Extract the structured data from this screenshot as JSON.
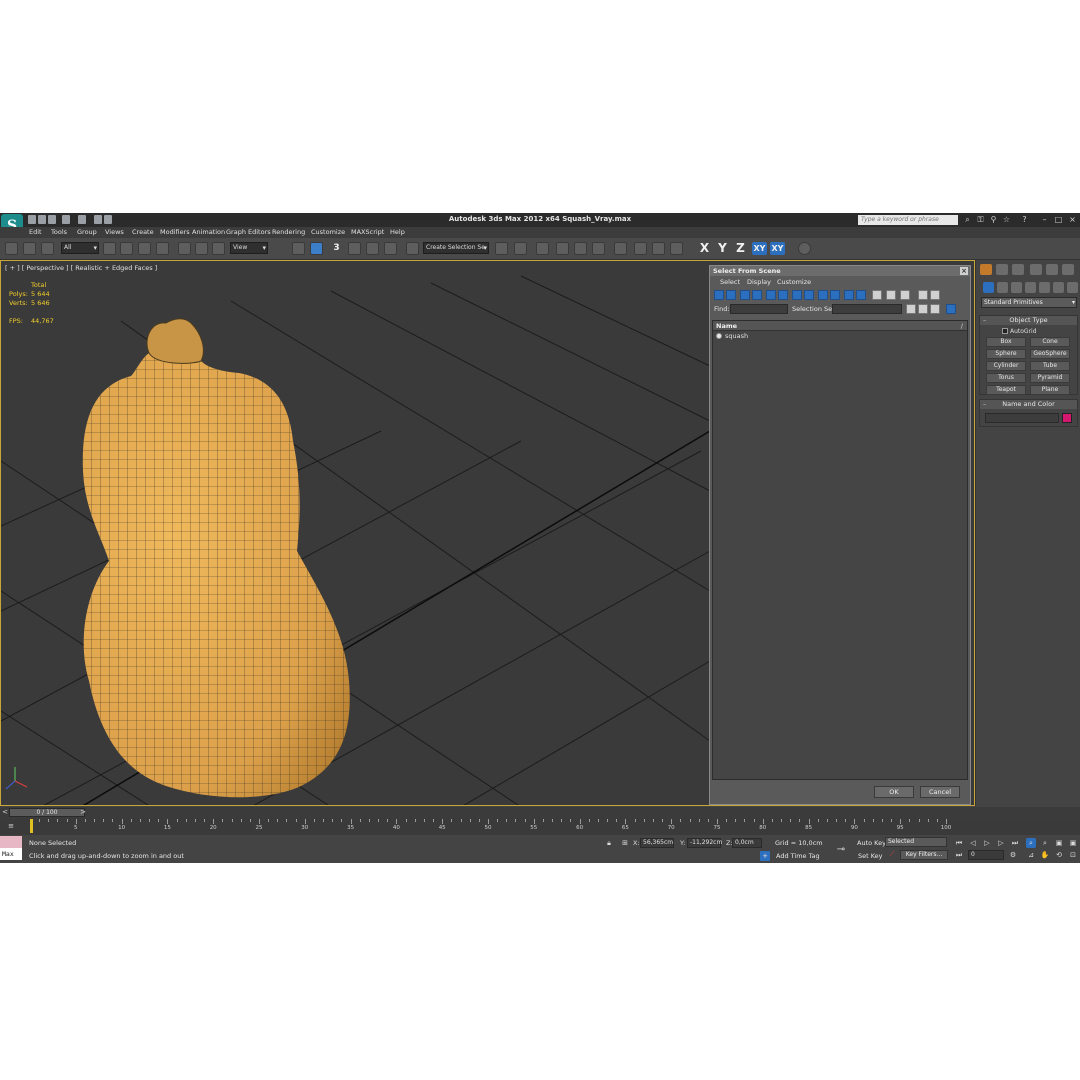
{
  "app": {
    "title": "Autodesk 3ds Max  2012 x64    Squash_Vray.max",
    "search_placeholder": "Type a keyword or phrase",
    "logo_letter": "S"
  },
  "menu": [
    "Edit",
    "Tools",
    "Group",
    "Views",
    "Create",
    "Modifiers",
    "Animation",
    "Graph Editors",
    "Rendering",
    "Customize",
    "MAXScript",
    "Help"
  ],
  "toolbar": {
    "filter_value": "All",
    "coord_value": "View",
    "selection_set_value": "Create Selection Se",
    "snap_label": "3",
    "axis_x": "X",
    "axis_y": "Y",
    "axis_z": "Z",
    "axis_xy": "XY",
    "axis_xy2": "XY"
  },
  "viewport": {
    "label": "[ + ] [ Perspective ] [ Realistic + Edged Faces ]",
    "stats": {
      "total_label": "Total",
      "polys_label": "Polys:",
      "polys_value": "5 644",
      "verts_label": "Verts:",
      "verts_value": "5 646",
      "fps_label": "FPS:",
      "fps_value": "44,767"
    },
    "object_color": "#e3a84a"
  },
  "dialog": {
    "title": "Select From Scene",
    "menu": [
      "Select",
      "Display",
      "Customize"
    ],
    "find_label": "Find:",
    "selection_set_label": "Selection Set:",
    "column_name": "Name",
    "items": [
      "squash"
    ],
    "ok_label": "OK",
    "cancel_label": "Cancel"
  },
  "command_panel": {
    "category_value": "Standard Primitives",
    "object_type_title": "Object Type",
    "autogrid_label": "AutoGrid",
    "primitives": [
      "Box",
      "Cone",
      "Sphere",
      "GeoSphere",
      "Cylinder",
      "Tube",
      "Torus",
      "Pyramid",
      "Teapot",
      "Plane"
    ],
    "name_color_title": "Name and Color",
    "swatch_color": "#d4176f"
  },
  "timeline": {
    "slider_label": "0 / 100",
    "ticks": [
      "5",
      "10",
      "15",
      "20",
      "25",
      "30",
      "35",
      "40",
      "45",
      "50",
      "55",
      "60",
      "65",
      "70",
      "75",
      "80",
      "85",
      "90",
      "95",
      "100"
    ]
  },
  "status": {
    "max_label": "Max",
    "selection_text": "None Selected",
    "prompt_text": "Click and drag up-and-down to zoom in and out",
    "x_label": "X:",
    "x_value": "56,365cm",
    "y_label": "Y:",
    "y_value": "-11,292cm",
    "z_label": "Z:",
    "z_value": "0,0cm",
    "grid_text": "Grid = 10,0cm",
    "add_time_tag": "Add Time Tag",
    "auto_key": "Auto Key",
    "set_key": "Set Key",
    "selected_value": "Selected",
    "key_filters": "Key Filters...",
    "frame_value": "0"
  }
}
